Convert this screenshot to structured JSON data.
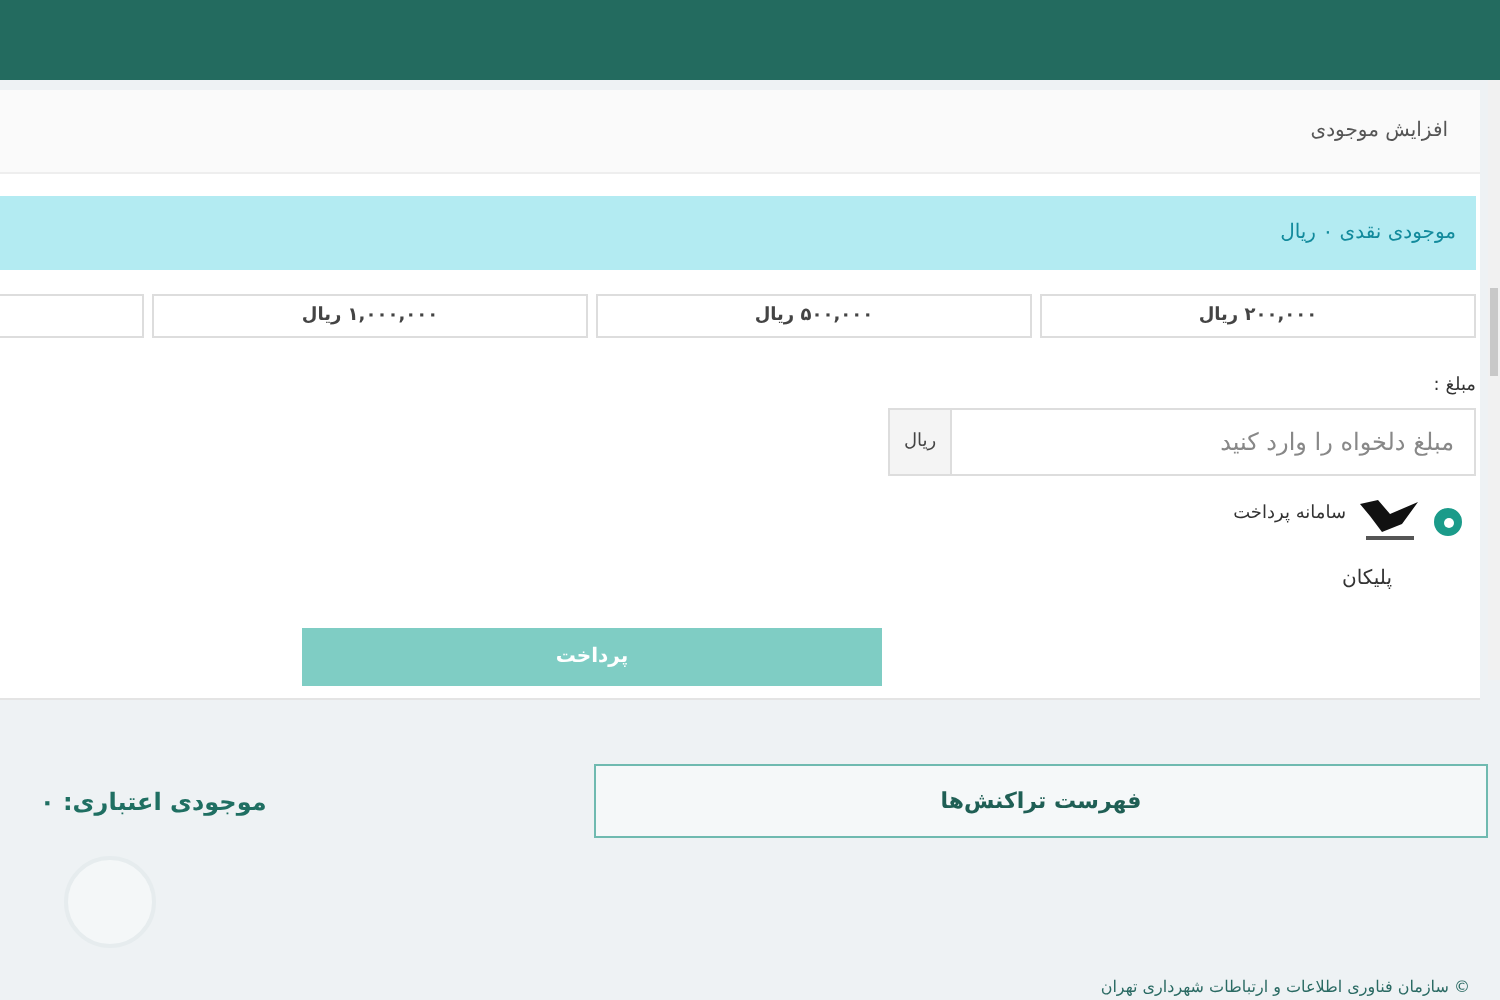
{
  "card": {
    "title": "افزایش موجودی",
    "balance_alert": "موجودی نقدی ۰ ریال"
  },
  "amount_options": [
    {
      "label": "۲۰۰,۰۰۰ ریال"
    },
    {
      "label": "۵۰۰,۰۰۰ ریال"
    },
    {
      "label": "۱,۰۰۰,۰۰۰ ریال"
    }
  ],
  "amount_field": {
    "label": "مبلغ :",
    "placeholder": "مبلغ دلخواه را وارد کنید",
    "unit": "ریال"
  },
  "gateways": [
    {
      "label": "سامانه پرداخت",
      "name": "پلیکان",
      "selected": true
    }
  ],
  "pay_button": {
    "label": "پرداخت",
    "disabled": true
  },
  "transactions_button": "فهرست تراکنش‌ها",
  "credit_balance": "موجودی اعتباری: ۰",
  "footer": "© سازمان فناوری اطلاعات و ارتباطات شهرداری تهران"
}
